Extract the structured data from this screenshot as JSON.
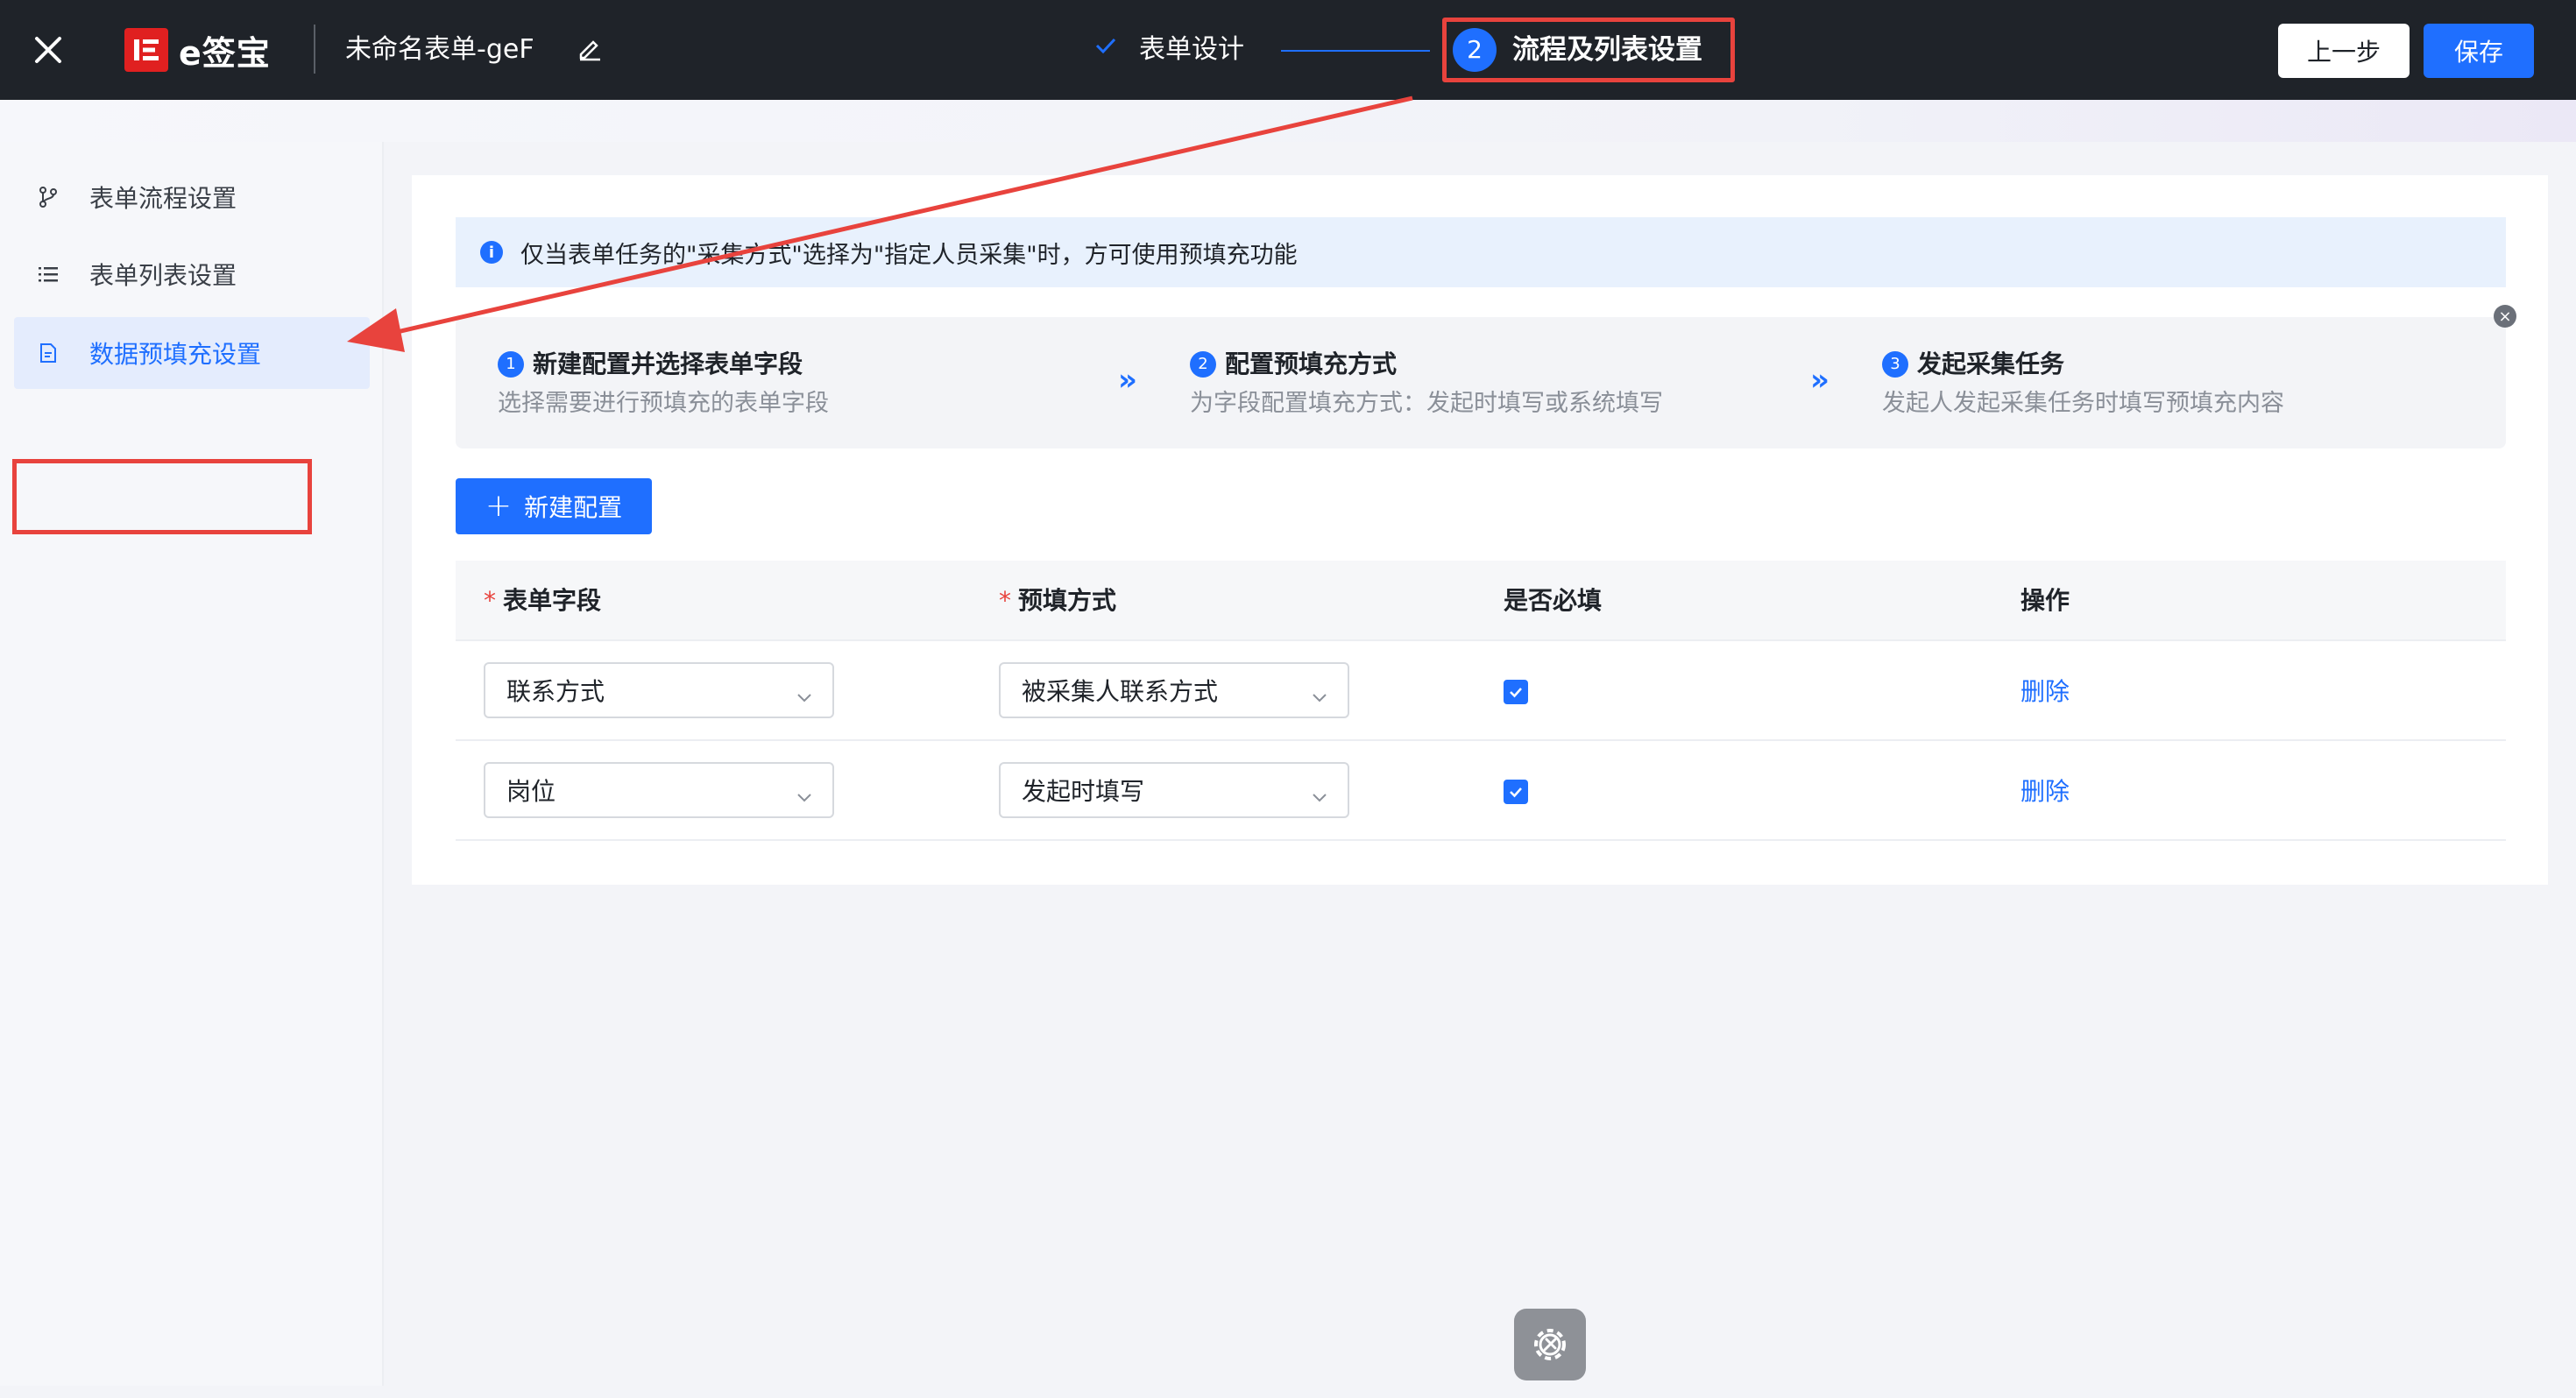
{
  "header": {
    "brand": "e签宝",
    "form_title": "未命名表单-geF",
    "step1_label": "表单设计",
    "step2_num": "2",
    "step2_label": "流程及列表设置",
    "prev_label": "上一步",
    "save_label": "保存"
  },
  "sidebar": {
    "items": [
      {
        "label": "表单流程设置",
        "icon": "branch-icon"
      },
      {
        "label": "表单列表设置",
        "icon": "list-icon"
      },
      {
        "label": "数据预填充设置",
        "icon": "document-icon",
        "active": true
      }
    ]
  },
  "info": {
    "text": "仅当表单任务的\"采集方式\"选择为\"指定人员采集\"时，方可使用预填充功能"
  },
  "guide": {
    "steps": [
      {
        "num": "1",
        "title": "新建配置并选择表单字段",
        "desc": "选择需要进行预填充的表单字段"
      },
      {
        "num": "2",
        "title": "配置预填充方式",
        "desc": "为字段配置填充方式：发起时填写或系统填写"
      },
      {
        "num": "3",
        "title": "发起采集任务",
        "desc": "发起人发起采集任务时填写预填充内容"
      }
    ],
    "arrow": "»",
    "close": "×"
  },
  "new_config_label": "新建配置",
  "table": {
    "required_mark": "*",
    "columns": [
      "表单字段",
      "预填方式",
      "是否必填",
      "操作"
    ],
    "rows": [
      {
        "field": "联系方式",
        "mode": "被采集人联系方式",
        "required": true,
        "action": "删除"
      },
      {
        "field": "岗位",
        "mode": "发起时填写",
        "required": true,
        "action": "删除"
      }
    ]
  },
  "colors": {
    "accent": "#1f6fff",
    "topbar": "#1f2329",
    "annotation": "#e8433d"
  }
}
